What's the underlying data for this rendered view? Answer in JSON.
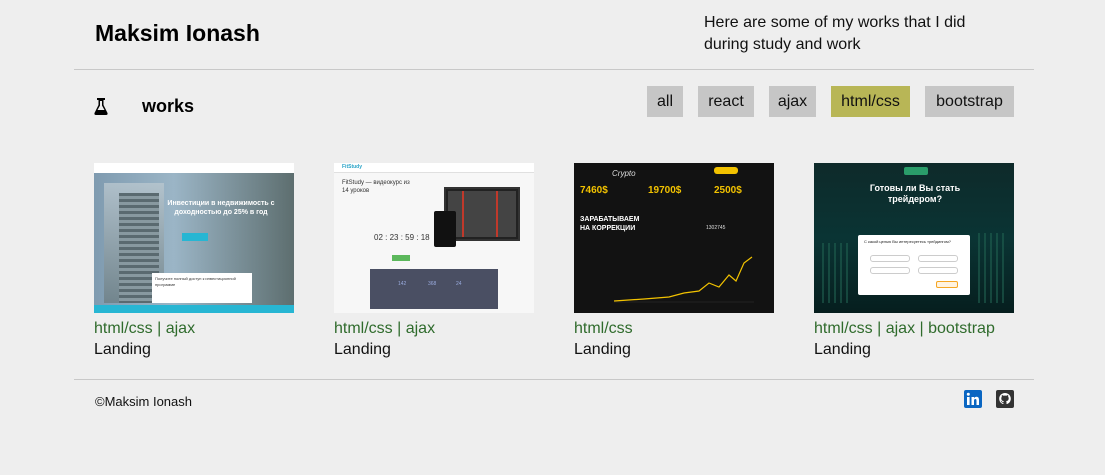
{
  "header": {
    "title": "Maksim Ionash",
    "intro": "Here are some of my works that I did during study and work"
  },
  "works": {
    "title": "works",
    "icon": "flask-icon",
    "filters": [
      {
        "label": "all",
        "active": false
      },
      {
        "label": "react",
        "active": false
      },
      {
        "label": "ajax",
        "active": false
      },
      {
        "label": "html/css",
        "active": true
      },
      {
        "label": "bootstrap",
        "active": false
      }
    ],
    "accent_color": "#b8b656",
    "tag_color": "#2f6b2c"
  },
  "cards": [
    {
      "tags": [
        "html/css",
        "ajax"
      ],
      "type": "Landing",
      "thumb": {
        "headline": "Инвестиции в недвижимость с доходностью до 25% в год",
        "box_text": "Получите полный доступ к инвестиционной программе"
      }
    },
    {
      "tags": [
        "html/css",
        "ajax"
      ],
      "type": "Landing",
      "thumb": {
        "brand": "FitStudy",
        "headline": "FitStudy — видеокурс из 14 уроков",
        "timer": "02 : 23 : 59 : 18",
        "stats": [
          "142",
          "368",
          "24"
        ]
      }
    },
    {
      "tags": [
        "html/css"
      ],
      "type": "Landing",
      "thumb": {
        "brand": "Crypto",
        "stats": [
          "7460$",
          "19700$",
          "2500$"
        ],
        "headline": "ЗАРАБАТЫВАЕМ НА КОРРЕКЦИИ",
        "value": "1302745"
      }
    },
    {
      "tags": [
        "html/css",
        "ajax",
        "bootstrap"
      ],
      "type": "Landing",
      "thumb": {
        "headline": "Готовы ли Вы стать трейдером?",
        "form_title": "С какой целью Вы интересуетесь трейдингом?"
      }
    }
  ],
  "footer": {
    "copyright": "©Maksim Ionash",
    "social": [
      {
        "name": "linkedin-icon",
        "color": "#0a66c2"
      },
      {
        "name": "github-icon",
        "color": "#333333"
      }
    ]
  }
}
